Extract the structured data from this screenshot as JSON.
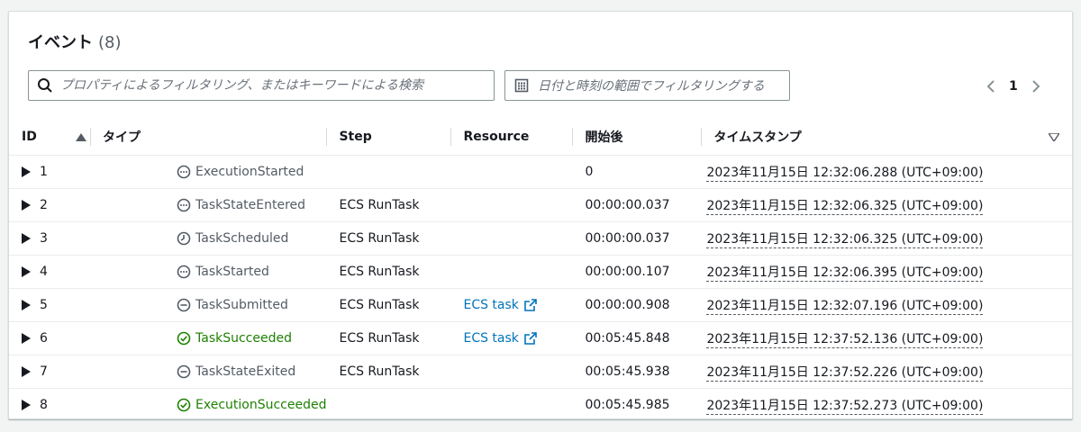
{
  "header": {
    "title": "イベント",
    "count": "(8)"
  },
  "search": {
    "placeholder": "プロパティによるフィルタリング、またはキーワードによる検索"
  },
  "date_filter": {
    "label": "日付と時刻の範囲でフィルタリングする"
  },
  "pagination": {
    "current_page": "1"
  },
  "columns": {
    "id": "ID",
    "type": "タイプ",
    "step": "Step",
    "resource": "Resource",
    "elapsed": "開始後",
    "timestamp": "タイムスタンプ"
  },
  "rows": [
    {
      "id": "1",
      "type": "ExecutionStarted",
      "status": "in-progress",
      "step": "",
      "resource": "",
      "elapsed": "0",
      "timestamp": "2023年11月15日 12:32:06.288 (UTC+09:00)"
    },
    {
      "id": "2",
      "type": "TaskStateEntered",
      "status": "in-progress",
      "step": "ECS RunTask",
      "resource": "",
      "elapsed": "00:00:00.037",
      "timestamp": "2023年11月15日 12:32:06.325 (UTC+09:00)"
    },
    {
      "id": "3",
      "type": "TaskScheduled",
      "status": "pending",
      "step": "ECS RunTask",
      "resource": "",
      "elapsed": "00:00:00.037",
      "timestamp": "2023年11月15日 12:32:06.325 (UTC+09:00)"
    },
    {
      "id": "4",
      "type": "TaskStarted",
      "status": "in-progress",
      "step": "ECS RunTask",
      "resource": "",
      "elapsed": "00:00:00.107",
      "timestamp": "2023年11月15日 12:32:06.395 (UTC+09:00)"
    },
    {
      "id": "5",
      "type": "TaskSubmitted",
      "status": "stopped",
      "step": "ECS RunTask",
      "resource": "ECS task",
      "elapsed": "00:00:00.908",
      "timestamp": "2023年11月15日 12:32:07.196 (UTC+09:00)"
    },
    {
      "id": "6",
      "type": "TaskSucceeded",
      "status": "success",
      "step": "ECS RunTask",
      "resource": "ECS task",
      "elapsed": "00:05:45.848",
      "timestamp": "2023年11月15日 12:37:52.136 (UTC+09:00)"
    },
    {
      "id": "7",
      "type": "TaskStateExited",
      "status": "stopped",
      "step": "ECS RunTask",
      "resource": "",
      "elapsed": "00:05:45.938",
      "timestamp": "2023年11月15日 12:37:52.226 (UTC+09:00)"
    },
    {
      "id": "8",
      "type": "ExecutionSucceeded",
      "status": "success",
      "step": "",
      "resource": "",
      "elapsed": "00:05:45.985",
      "timestamp": "2023年11月15日 12:37:52.273 (UTC+09:00)"
    }
  ],
  "colors": {
    "success": "#1d8102",
    "link": "#0073bb",
    "muted": "#545b64"
  },
  "icons": {
    "in-progress": "ellipsis-circle-icon",
    "pending": "clock-icon",
    "stopped": "minus-circle-icon",
    "success": "check-circle-icon"
  }
}
